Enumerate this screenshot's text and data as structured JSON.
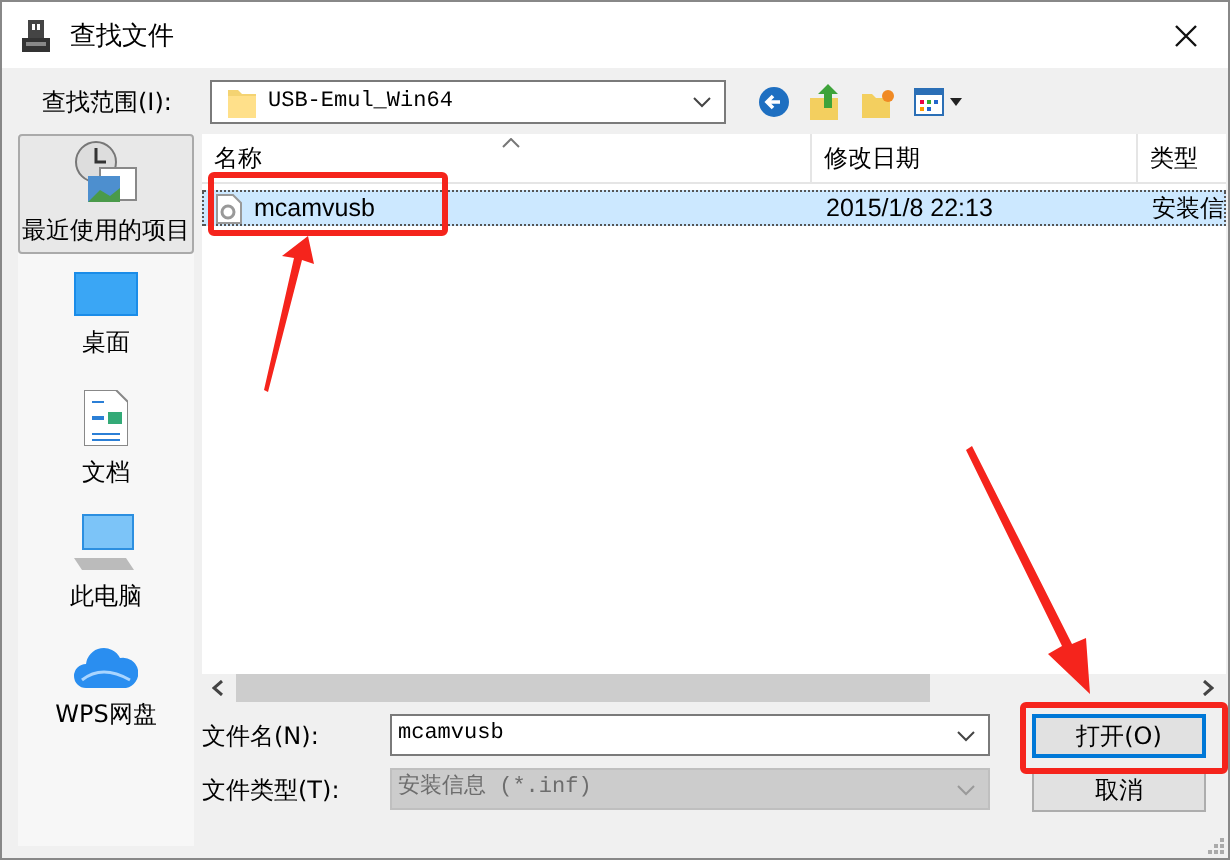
{
  "window": {
    "title": "查找文件"
  },
  "look_in": {
    "label": "查找范围(I):",
    "value": "USB-Emul_Win64"
  },
  "places": [
    {
      "label": "最近使用的项目",
      "kind": "recent",
      "selected": true
    },
    {
      "label": "桌面",
      "kind": "desktop",
      "selected": false
    },
    {
      "label": "文档",
      "kind": "documents",
      "selected": false
    },
    {
      "label": "此电脑",
      "kind": "computer",
      "selected": false
    },
    {
      "label": "WPS网盘",
      "kind": "cloud",
      "selected": false
    }
  ],
  "table": {
    "columns": [
      "名称",
      "修改日期",
      "类型"
    ],
    "rows": [
      {
        "cells": [
          "mcamvusb",
          "2015/1/8 22:13",
          "安装信"
        ],
        "selected": true
      }
    ]
  },
  "file_name": {
    "label": "文件名(N):",
    "value": "mcamvusb"
  },
  "file_type": {
    "label": "文件类型(T):",
    "value": "安装信息 (*.inf)",
    "disabled": true
  },
  "buttons": [
    {
      "label": "打开(O)",
      "default": true
    },
    {
      "label": "取消",
      "default": false
    }
  ]
}
